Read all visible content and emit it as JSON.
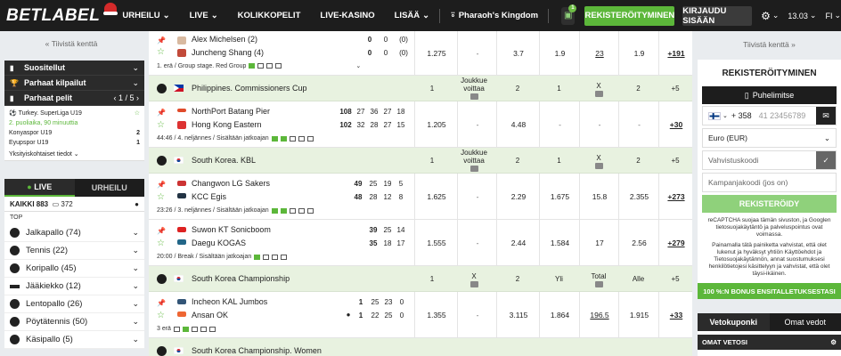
{
  "header": {
    "logo": "BETLABEL",
    "nav": [
      "URHEILU",
      "LIVE",
      "KOLIKKOPELIT",
      "LIVE-KASINO",
      "LISÄÄ"
    ],
    "game": "Pharaoh's Kingdom",
    "gift_count": "1",
    "register": "REKISTERÖITYMINEN",
    "login": "KIRJAUDU SISÄÄN",
    "time": "13.03",
    "lang": "FI"
  },
  "left": {
    "collapse": "Tiivistä kenttä",
    "rows": [
      {
        "icon": "▮",
        "label": "Suositellut",
        "right": "⌄"
      },
      {
        "icon": "🏆",
        "label": "Parhaat kilpailut",
        "right": "⌄"
      },
      {
        "icon": "▮",
        "label": "Parhaat pelit",
        "right": "‹  1 / 5  ›"
      }
    ],
    "top_match": {
      "league": "Turkey. SuperLiga U19",
      "status": "2. puoliaika, 90 minuuttia",
      "home": "Konyaspor U19",
      "home_score": "2",
      "away": "Eyupspor U19",
      "away_score": "1",
      "details": "Yksityiskohtaiset tiedot"
    },
    "tab_live": "LIVE",
    "tab_sport": "URHEILU",
    "all_label": "KAIKKI 883",
    "all_count": "372",
    "top": "TOP",
    "sports": [
      {
        "name": "Jalkapallo",
        "count": "(74)"
      },
      {
        "name": "Tennis",
        "count": "(22)"
      },
      {
        "name": "Koripallo",
        "count": "(45)"
      },
      {
        "name": "Jääkiekko",
        "count": "(12)"
      },
      {
        "name": "Lentopallo",
        "count": "(26)"
      },
      {
        "name": "Pöytätennis",
        "count": "(50)"
      },
      {
        "name": "Käsipallo",
        "count": "(5)"
      }
    ]
  },
  "events": {
    "ev0": {
      "home": "Alex Michelsen (2)",
      "away": "Juncheng Shang (4)",
      "hs": [
        "0",
        "0",
        "(0)"
      ],
      "as": [
        "0",
        "0",
        "(0)"
      ],
      "info": "1. erä / Group stage. Red Group",
      "odds": [
        "1.275",
        "-",
        "3.7",
        "1.9",
        "23",
        "1.9"
      ],
      "more": "+191"
    },
    "lg1": {
      "name": "Philippines. Commissioners Cup",
      "h": [
        "1",
        "Joukkue voittaa",
        "2",
        "1",
        "X",
        "2"
      ],
      "more": "+5"
    },
    "ev1": {
      "home": "NorthPort Batang Pier",
      "away": "Hong Kong Eastern",
      "hs": [
        "108",
        "27",
        "36",
        "27",
        "18"
      ],
      "as": [
        "102",
        "32",
        "28",
        "27",
        "15"
      ],
      "info": "44:46 / 4. neljännes / Sisältään jatkoajan",
      "odds": [
        "1.205",
        "-",
        "4.48",
        "-",
        "-",
        "-"
      ],
      "more": "+30"
    },
    "lg2": {
      "name": "South Korea. KBL",
      "h": [
        "1",
        "Joukkue voittaa",
        "2",
        "1",
        "X",
        "2"
      ],
      "more": "+5"
    },
    "ev2": {
      "home": "Changwon LG Sakers",
      "away": "KCC Egis",
      "hs": [
        "49",
        "25",
        "19",
        "5"
      ],
      "as": [
        "48",
        "28",
        "12",
        "8"
      ],
      "info": "23:26 / 3. neljännes / Sisältään jatkoajan",
      "odds": [
        "1.625",
        "-",
        "2.29",
        "1.675",
        "15.8",
        "2.355"
      ],
      "more": "+273"
    },
    "ev3": {
      "home": "Suwon KT Sonicboom",
      "away": "Daegu KOGAS",
      "hs": [
        "39",
        "25",
        "14"
      ],
      "as": [
        "35",
        "18",
        "17"
      ],
      "info": "20:00 / Break / Sisältään jatkoajan",
      "odds": [
        "1.555",
        "-",
        "2.44",
        "1.584",
        "17",
        "2.56"
      ],
      "more": "+279"
    },
    "lg3": {
      "name": "South Korea Championship",
      "h": [
        "1",
        "X",
        "2",
        "Yli",
        "Total",
        "Alle"
      ],
      "more": "+5"
    },
    "ev4": {
      "home": "Incheon KAL Jumbos",
      "away": "Ansan OK",
      "hs": [
        "1",
        "25",
        "23",
        "0"
      ],
      "as": [
        "1",
        "22",
        "25",
        "0"
      ],
      "info": "3 erä",
      "odds": [
        "1.355",
        "-",
        "3.115",
        "1.864",
        "196.5",
        "1.915"
      ],
      "more": "+33"
    },
    "lg4": {
      "name": "South Korea Championship. Women"
    }
  },
  "right": {
    "collapse": "Tiivistä kenttä",
    "reg_title": "REKISTERÖITYMINEN",
    "phone_btn": "Puhelimitse",
    "prefix": "+ 358",
    "phone_ph": "41 23456789",
    "currency": "Euro (EUR)",
    "confirm_ph": "Vahvistuskoodi",
    "promo_ph": "Kampanjakoodi (jos on)",
    "reg_btn": "REKISTERÖIDY",
    "legal1": "reCAPTCHA suojaa tämän sivuston, ja Googlen tietosuojakäytäntö ja palveluspointus ovat voimassa.",
    "legal2": "Painamalla tätä painiketta vahvistat, että olet lukenut ja hyväksyt yhtiön Käyttöehdot ja Tietosuojakäytännön, annat suostumuksesi henkilötietojesi käsittelyyn ja vahvistat, että olet täysi-ikäinen.",
    "bonus": "100 %:N BONUS ENSITALLETUKSESTASI",
    "slip_tab1": "Vetokuponki",
    "slip_tab2": "Omat vedot",
    "own_bets": "OMAT VETOSI"
  },
  "colors": {
    "brand_green": "#5cb73a",
    "header": "#1d1d1d",
    "league_row": "#e8f2e0"
  }
}
